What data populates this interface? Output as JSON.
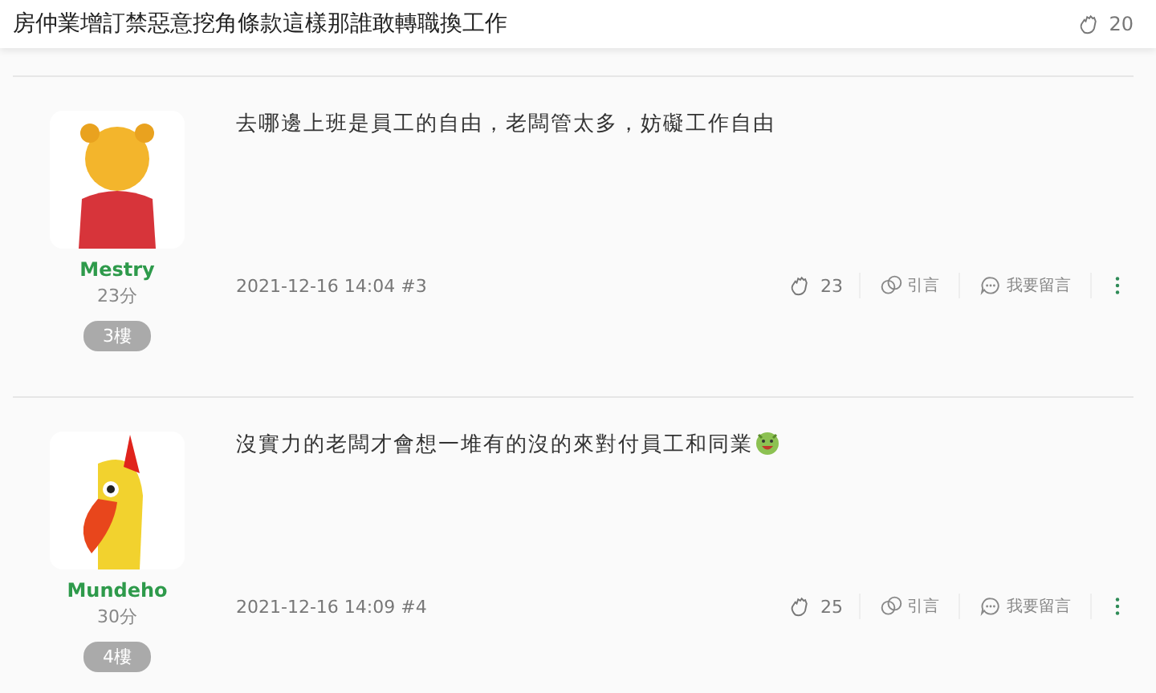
{
  "header": {
    "title": "房仲業增訂禁惡意挖角條款這樣那誰敢轉職換工作",
    "likes": "20"
  },
  "posts": [
    {
      "author": "Mestry",
      "score": "23分",
      "floor": "3樓",
      "content": "去哪邊上班是員工的自由，老闆管太多，妨礙工作自由",
      "emoji": false,
      "meta": "2021-12-16 14:04 #3",
      "likes": "23",
      "quote": "引言",
      "reply": "我要留言"
    },
    {
      "author": "Mundeho",
      "score": "30分",
      "floor": "4樓",
      "content": "沒實力的老闆才會想一堆有的沒的來對付員工和同業",
      "emoji": true,
      "meta": "2021-12-16 14:09 #4",
      "likes": "25",
      "quote": "引言",
      "reply": "我要留言"
    }
  ]
}
